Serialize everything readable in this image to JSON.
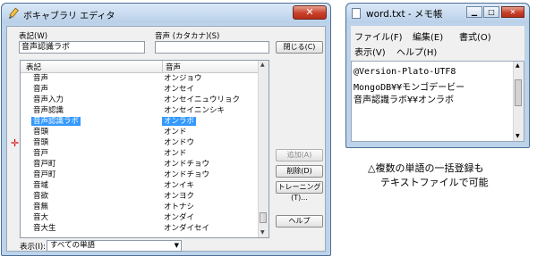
{
  "vocab": {
    "title": "ボキャブラリ エディタ",
    "notation_label": "表記(W)",
    "notation_value": "音声認識ラボ",
    "reading_label": "音声 (カタカナ)(S)",
    "reading_value": "",
    "buttons": {
      "close": "閉じる(C)",
      "add": "追加(A)",
      "delete": "削除(D)",
      "training": "トレーニング(T)...",
      "help": "ヘルプ"
    },
    "columns": [
      "表記",
      "音声"
    ],
    "rows": [
      {
        "notation": "音声",
        "reading": "オンジョウ"
      },
      {
        "notation": "音声",
        "reading": "オンセイ"
      },
      {
        "notation": "音声入力",
        "reading": "オンセイニュウリョク"
      },
      {
        "notation": "音声認識",
        "reading": "オンセイニンシキ"
      },
      {
        "notation": "音声認識ラボ",
        "reading": "オンラボ",
        "selected": true
      },
      {
        "notation": "音頭",
        "reading": "オンド"
      },
      {
        "notation": "音頭",
        "reading": "オンドウ"
      },
      {
        "notation": "音戸",
        "reading": "オンド"
      },
      {
        "notation": "音戸町",
        "reading": "オンドチョウ"
      },
      {
        "notation": "音戸町",
        "reading": "オンドチョウ"
      },
      {
        "notation": "音域",
        "reading": "オンイキ"
      },
      {
        "notation": "音欲",
        "reading": "オンヨク"
      },
      {
        "notation": "音無",
        "reading": "オトナシ"
      },
      {
        "notation": "音大",
        "reading": "オンダイ"
      },
      {
        "notation": "音大生",
        "reading": "オンダイセイ"
      }
    ],
    "display_label": "表示(I):",
    "display_value": "すべての単語"
  },
  "notepad": {
    "title": "word.txt - メモ帳",
    "menu": [
      "ファイル(F)",
      "編集(E)",
      "書式(O)",
      "表示(V)",
      "ヘルプ(H)"
    ],
    "lines": [
      "@Version-Plato-UTF8",
      "MongoDB¥¥モンゴデービー",
      "音声認識ラボ¥¥オンラボ"
    ]
  },
  "caption": [
    "△複数の単語の一括登録も",
    "テキストファイルで可能"
  ],
  "colors": {
    "selection": "#3399ff",
    "pointer": "#d00000",
    "title_bar": "#b8cfe8"
  }
}
